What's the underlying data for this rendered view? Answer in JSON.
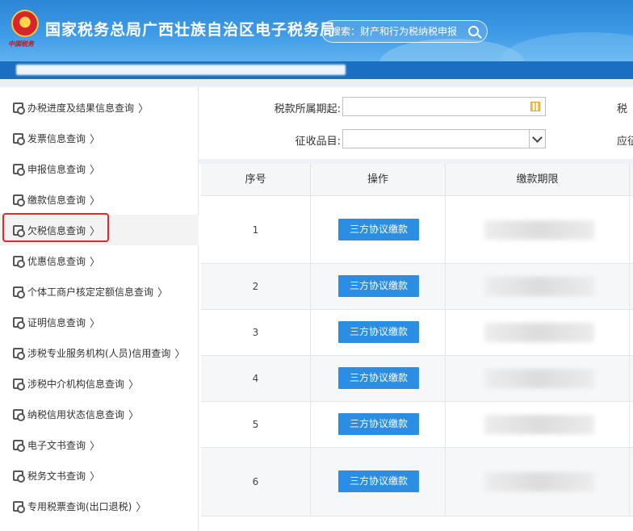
{
  "header": {
    "title": "国家税务总局广西壮族自治区电子税务局",
    "emblem_caption": "中国税务",
    "search_placeholder": "搜索：财产和行为税纳税申报"
  },
  "sidebar": {
    "items": [
      {
        "label": "办税进度及结果信息查询",
        "icon": "search-doc-icon"
      },
      {
        "label": "发票信息查询",
        "icon": "invoice-search-icon"
      },
      {
        "label": "申报信息查询",
        "icon": "declaration-search-icon"
      },
      {
        "label": "缴款信息查询",
        "icon": "payment-search-icon"
      },
      {
        "label": "欠税信息查询",
        "icon": "arrears-search-icon"
      },
      {
        "label": "优惠信息查询",
        "icon": "chart-search-icon"
      },
      {
        "label": "个体工商户核定定额信息查询",
        "icon": "doc-search-icon"
      },
      {
        "label": "证明信息查询",
        "icon": "certificate-search-icon"
      },
      {
        "label": "涉税专业服务机构(人员)信用查询",
        "icon": "agency-search-icon"
      },
      {
        "label": "涉税中介机构信息查询",
        "icon": "agency-search-icon"
      },
      {
        "label": "纳税信用状态信息查询",
        "icon": "credit-search-icon"
      },
      {
        "label": "电子文书查询",
        "icon": "edoc-search-icon"
      },
      {
        "label": "税务文书查询",
        "icon": "tax-doc-search-icon"
      },
      {
        "label": "专用税票查询(出口退税)",
        "icon": "ticket-search-icon"
      }
    ],
    "chevron": "〉"
  },
  "filters": {
    "period_start_label": "税款所属期起:",
    "period_start_value": "",
    "item_label": "征收品目:",
    "item_value": "",
    "right_label_1": "税",
    "right_label_2": "应征"
  },
  "table": {
    "headers": [
      "序号",
      "操作",
      "缴款期限"
    ],
    "rows": [
      {
        "index": "1",
        "action": "三方协议缴款"
      },
      {
        "index": "2",
        "action": "三方协议缴款"
      },
      {
        "index": "3",
        "action": "三方协议缴款"
      },
      {
        "index": "4",
        "action": "三方协议缴款"
      },
      {
        "index": "5",
        "action": "三方协议缴款"
      },
      {
        "index": "6",
        "action": "三方协议缴款"
      }
    ]
  },
  "colors": {
    "header_blue": "#2b86d6",
    "button_blue": "#2b8ee3",
    "highlight_red": "#e5262a"
  }
}
